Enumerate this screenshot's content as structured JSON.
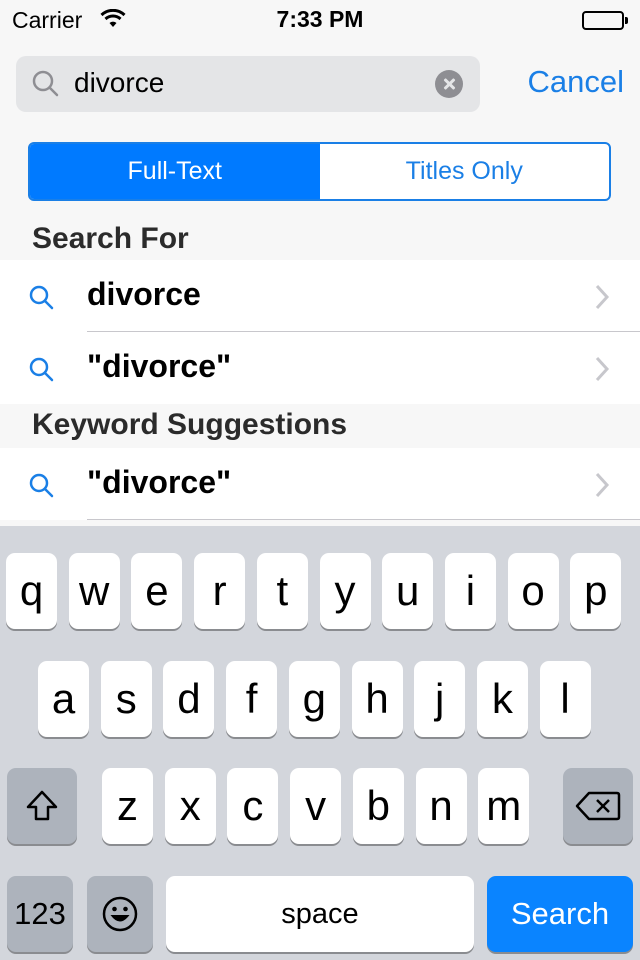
{
  "status_bar": {
    "carrier": "Carrier",
    "time": "7:33 PM"
  },
  "search": {
    "value": "divorce",
    "cancel_label": "Cancel"
  },
  "segmented": {
    "options": [
      "Full-Text",
      "Titles Only"
    ],
    "selected": "Full-Text"
  },
  "sections": [
    {
      "header": "Search For",
      "items": [
        {
          "label": "divorce"
        },
        {
          "label": "\"divorce\""
        }
      ]
    },
    {
      "header": "Keyword Suggestions",
      "items": [
        {
          "label": "\"divorce\""
        }
      ]
    }
  ],
  "keyboard": {
    "row1": [
      "q",
      "w",
      "e",
      "r",
      "t",
      "y",
      "u",
      "i",
      "o",
      "p"
    ],
    "row2": [
      "a",
      "s",
      "d",
      "f",
      "g",
      "h",
      "j",
      "k",
      "l"
    ],
    "row3": [
      "z",
      "x",
      "c",
      "v",
      "b",
      "n",
      "m"
    ],
    "numbers_label": "123",
    "space_label": "space",
    "return_label": "Search"
  },
  "colors": {
    "accent": "#007aff",
    "link": "#1a7fe6",
    "keyboard_bg": "#d3d6dc"
  }
}
